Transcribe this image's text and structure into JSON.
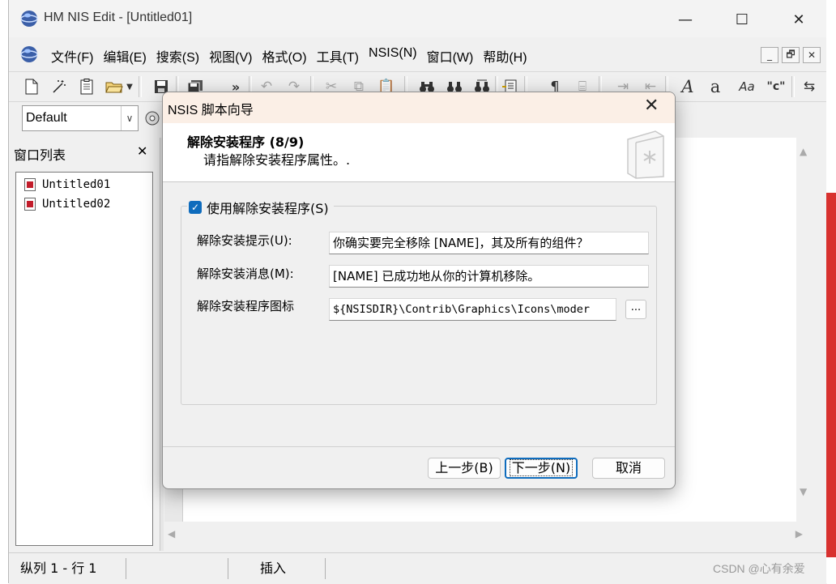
{
  "window": {
    "title": "HM NIS Edit - [Untitled01]",
    "minimize": "—",
    "maximize": "☐",
    "close": "✕"
  },
  "menu": {
    "items": [
      "文件(F)",
      "编辑(E)",
      "搜索(S)",
      "视图(V)",
      "格式(O)",
      "工具(T)",
      "NSIS(N)",
      "窗口(W)",
      "帮助(H)"
    ],
    "mdi_minimize": "_",
    "mdi_restore": "🗗",
    "mdi_close": "✕"
  },
  "toolbar": {
    "overflow": "»",
    "font_a_serif": "A",
    "font_a_small": "a",
    "font_aa": "Aa",
    "quote_c": "\"c\""
  },
  "format_combo": {
    "value": "Default"
  },
  "window_list": {
    "title": "窗口列表",
    "close": "✕",
    "items": [
      "Untitled01",
      "Untitled02"
    ]
  },
  "status_bar": {
    "position": "纵列 1 - 行 1",
    "mode": "插入"
  },
  "watermark": "CSDN @心有余爱",
  "dialog": {
    "title": "NSIS 脚本向导",
    "close": "✕",
    "step_title": "解除安装程序 (8/9)",
    "step_desc": "请指解除安装程序属性。.",
    "use_uninstaller_label": "使用解除安装程序(S)",
    "use_uninstaller_checked": true,
    "fields": {
      "prompt_label": "解除安装提示(U):",
      "prompt_value": "你确实要完全移除 [NAME]，其及所有的组件？",
      "message_label": "解除安装消息(M):",
      "message_value": "[NAME] 已成功地从你的计算机移除。",
      "icon_label": "解除安装程序图标",
      "icon_value": "${NSISDIR}\\Contrib\\Graphics\\Icons\\moder",
      "browse_label": "..."
    },
    "buttons": {
      "back": "上一步(B)",
      "next": "下一步(N)",
      "cancel": "取消"
    }
  },
  "colors": {
    "accent": "#0f6cbd",
    "dialog_title_bg": "#fbefe6",
    "background_red": "#d8312f"
  }
}
